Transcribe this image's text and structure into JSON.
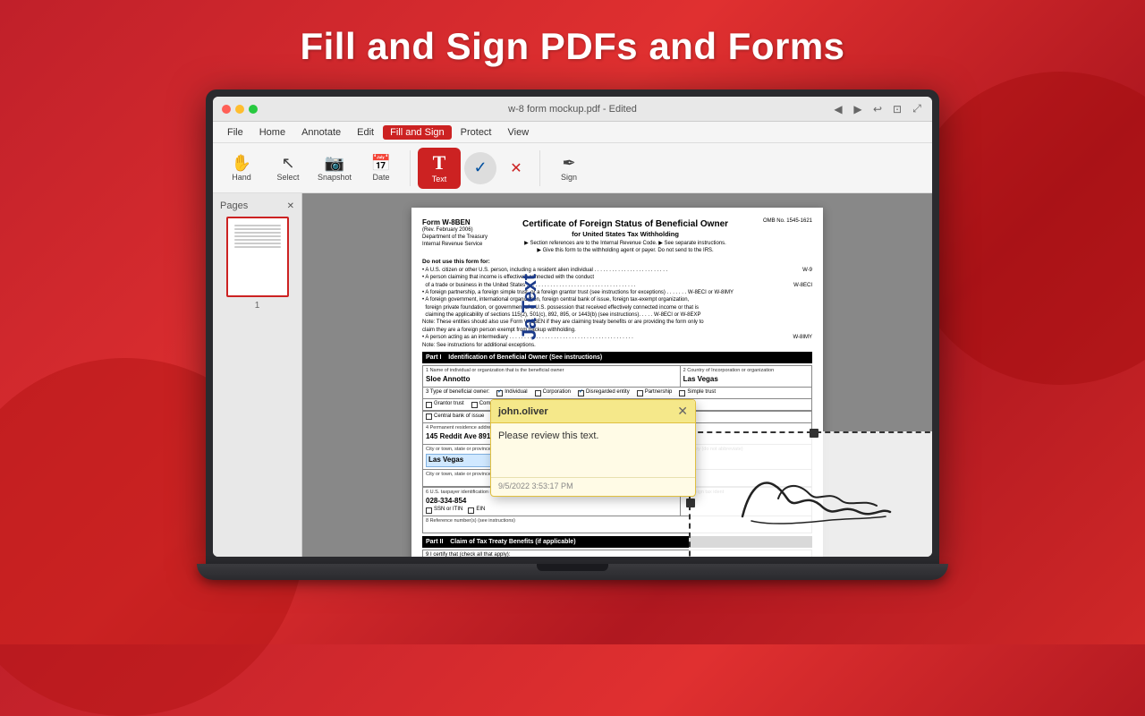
{
  "page": {
    "title": "Fill and Sign PDFs and Forms",
    "bg_color": "#cc2020"
  },
  "titlebar": {
    "title": "w-8 form mockup.pdf - Edited",
    "dots": [
      "red",
      "yellow",
      "green"
    ],
    "icons": [
      "◀",
      "▶",
      "↩",
      "⊡",
      "⤢"
    ]
  },
  "menubar": {
    "items": [
      "File",
      "Home",
      "Annotate",
      "Edit",
      "Fill and Sign",
      "Protect",
      "View"
    ],
    "active": "Fill and Sign"
  },
  "toolbar": {
    "tools": [
      {
        "id": "hand",
        "label": "Hand",
        "icon": "✋"
      },
      {
        "id": "select",
        "label": "Select",
        "icon": "↖"
      },
      {
        "id": "snapshot",
        "label": "Snapshot",
        "icon": "📷"
      },
      {
        "id": "date",
        "label": "Date",
        "icon": "📅"
      },
      {
        "id": "text",
        "label": "Text",
        "icon": "T",
        "active": true
      },
      {
        "id": "checkmark",
        "label": "",
        "icon": "✓"
      },
      {
        "id": "cross",
        "label": "",
        "icon": "✕"
      },
      {
        "id": "sign",
        "label": "Sign",
        "icon": "✒"
      }
    ]
  },
  "sidebar": {
    "title": "Pages",
    "page_number": "1"
  },
  "form": {
    "name": "W-8BEN",
    "title": "Certificate of Foreign Status of Beneficial Owner",
    "subtitle": "for United States Tax Withholding",
    "omb": "OMB No. 1545-1621",
    "revision": "(Rev. February 2006)",
    "dept": "Department of the Treasury",
    "irs": "Internal Revenue Service",
    "part1_label": "Part I",
    "part1_title": "Identification of Beneficial Owner (See instructions)",
    "part2_label": "Part II",
    "part2_title": "Claim of Tax Treaty Benefits (if applicable)",
    "fields": {
      "name": "Sloe Annotto",
      "country": "Las Vegas",
      "beneficial_owner_type": "Individual",
      "ssn": "028-334-854",
      "address": "145 Reddit Ave 89110",
      "city": "Las Vegas"
    },
    "checkboxes": {
      "individual": true,
      "corporation": false,
      "disregarded_entity": true,
      "partnership": false,
      "simple_trust": false,
      "grantor_trust": false,
      "complex_trust": false,
      "estate": false,
      "government": false,
      "international_org": false,
      "central_bank": false,
      "tax_exempt": true,
      "private_foundation": false
    }
  },
  "comment": {
    "author": "john.oliver",
    "text": "Please review this text.",
    "timestamp": "9/5/2022 3:53:17 PM"
  },
  "annotation": {
    "ja_text": "Ja Text"
  },
  "signature": {
    "label": "Signature"
  }
}
